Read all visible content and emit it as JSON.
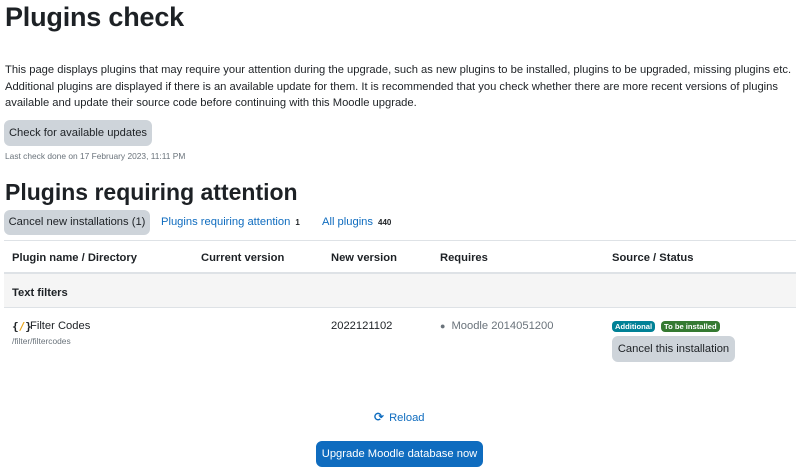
{
  "page": {
    "title": "Plugins check",
    "intro": "This page displays plugins that may require your attention during the upgrade, such as new plugins to be installed, plugins to be upgraded, missing plugins etc. Additional plugins are displayed if there is an available update for them. It is recommended that you check whether there are more recent versions of plugins available and update their source code before continuing with this Moodle upgrade."
  },
  "updates": {
    "check_label": "Check for available updates",
    "last_check": "Last check done on 17 February 2023, 11:11 PM"
  },
  "attention": {
    "title": "Plugins requiring attention",
    "filters": [
      {
        "label": "Cancel new installations (1)"
      },
      {
        "label": "Plugins requiring attention",
        "count": "1"
      },
      {
        "label": "All plugins",
        "count": "440"
      }
    ]
  },
  "table": {
    "headers": [
      "Plugin name / Directory",
      "Current version",
      "New version",
      "Requires",
      "Source / Status"
    ],
    "groups": [
      {
        "name": "Text filters",
        "rows": [
          {
            "icon": "filter-codes-icon",
            "name": "Filter Codes",
            "directory": "/filter/filtercodes",
            "current_version": "",
            "new_version": "2022121102",
            "requires": "Moodle 2014051200",
            "source_badge": "Additional",
            "status_badge": "To be installed",
            "action": "Cancel this installation"
          }
        ]
      }
    ]
  },
  "footer": {
    "reload_label": "Reload",
    "upgrade_label": "Upgrade Moodle database now"
  },
  "colors": {
    "primary": "#0f6cbf",
    "secondary_button": "#ced4da",
    "badge_additional": "#008196",
    "badge_install": "#357a32"
  }
}
